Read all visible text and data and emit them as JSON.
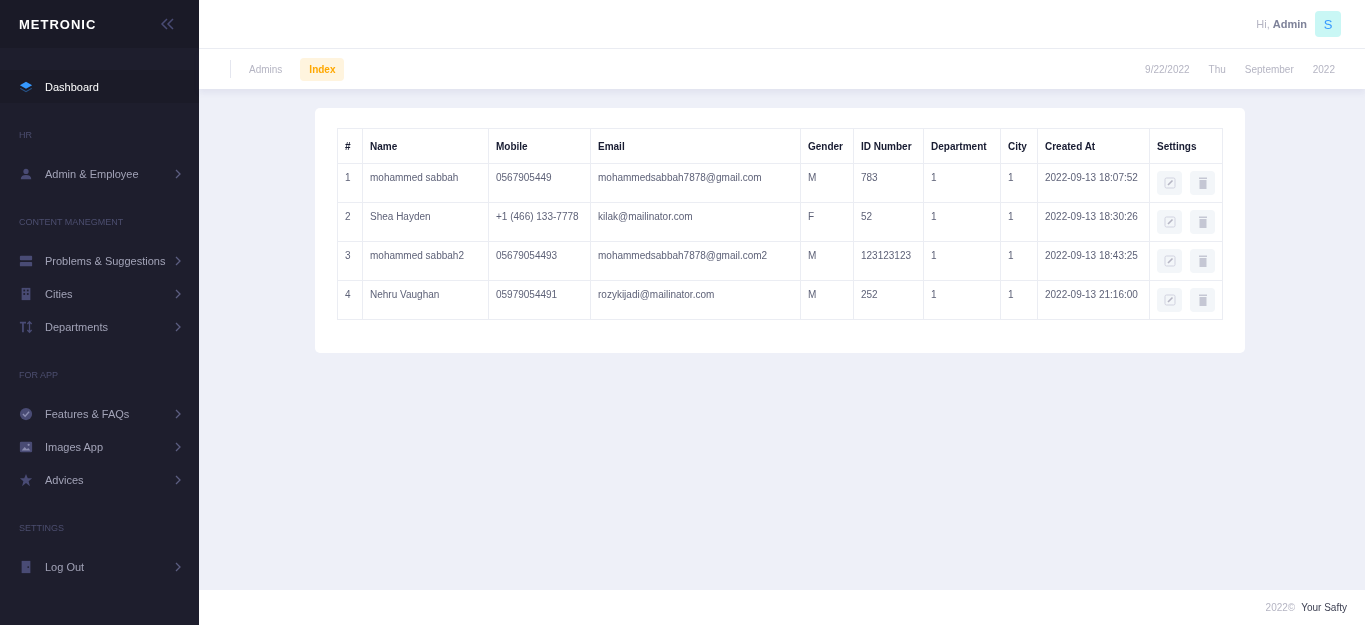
{
  "sidebar": {
    "logo": "METRONIC",
    "menu": [
      {
        "kind": "link",
        "label": "Dashboard",
        "selected": true,
        "has_submenu": false
      },
      {
        "kind": "section",
        "label": "HR"
      },
      {
        "kind": "link",
        "label": "Admin & Employee",
        "selected": false,
        "has_submenu": true
      },
      {
        "kind": "section",
        "label": "CONTENT MANEGMENT"
      },
      {
        "kind": "link",
        "label": "Problems & Suggestions",
        "selected": false,
        "has_submenu": true
      },
      {
        "kind": "link",
        "label": "Cities",
        "selected": false,
        "has_submenu": true
      },
      {
        "kind": "link",
        "label": "Departments",
        "selected": false,
        "has_submenu": true
      },
      {
        "kind": "section",
        "label": "FOR APP"
      },
      {
        "kind": "link",
        "label": "Features & FAQs",
        "selected": false,
        "has_submenu": true
      },
      {
        "kind": "link",
        "label": "Images App",
        "selected": false,
        "has_submenu": true
      },
      {
        "kind": "link",
        "label": "Advices",
        "selected": false,
        "has_submenu": true
      },
      {
        "kind": "section",
        "label": "SETTINGS"
      },
      {
        "kind": "link",
        "label": "Log Out",
        "selected": false,
        "has_submenu": true
      }
    ]
  },
  "header": {
    "greeting": "Hi,",
    "user": "Admin",
    "avatar": "S"
  },
  "subheader": {
    "breadcrumbs": [
      {
        "label": "Admins",
        "selected": false
      },
      {
        "label": "Index",
        "selected": true
      }
    ],
    "date_parts": [
      "9/22/2022",
      "Thu",
      "September",
      "2022"
    ]
  },
  "table": {
    "columns": [
      "#",
      "Name",
      "Mobile",
      "Email",
      "Gender",
      "ID Number",
      "Department",
      "City",
      "Created At",
      "Settings"
    ],
    "rows": [
      {
        "cells": [
          "1",
          "mohammed sabbah",
          "0567905449",
          "mohammedsabbah7878@gmail.com",
          "M",
          "783",
          "1",
          "1",
          "2022-09-13 18:07:52"
        ]
      },
      {
        "cells": [
          "2",
          "Shea Hayden",
          "+1 (466) 133-7778",
          "kilak@mailinator.com",
          "F",
          "52",
          "1",
          "1",
          "2022-09-13 18:30:26"
        ]
      },
      {
        "cells": [
          "3",
          "mohammed sabbah2",
          "05679054493",
          "mohammedsabbah7878@gmail.com2",
          "M",
          "123123123",
          "1",
          "1",
          "2022-09-13 18:43:25"
        ]
      },
      {
        "cells": [
          "4",
          "Nehru Vaughan",
          "05979054491",
          "rozykijadi@mailinator.com",
          "M",
          "252",
          "1",
          "1",
          "2022-09-13 21:16:00"
        ]
      }
    ]
  },
  "footer": {
    "year": "2022©",
    "brand": "Your Safty"
  }
}
